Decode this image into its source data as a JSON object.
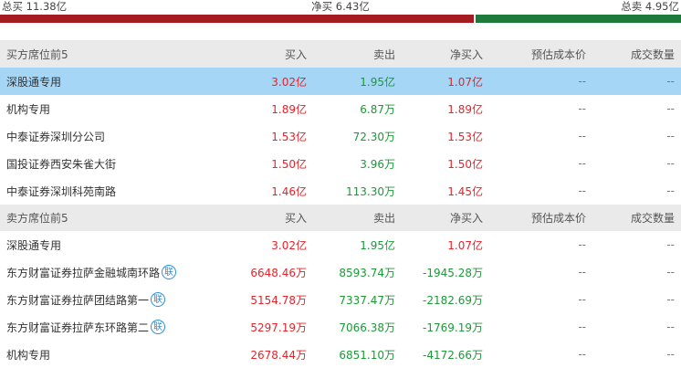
{
  "summary": {
    "total_buy_label": "总买 11.38亿",
    "net_buy_label": "净买 6.43亿",
    "total_sell_label": "总卖 4.95亿",
    "buy_bar_color": "#a61b1f",
    "sell_bar_color": "#1e7a3a",
    "buy_share": 0.697
  },
  "columns": {
    "buy": "买入",
    "sell": "卖出",
    "net": "净买入",
    "cost": "预估成本价",
    "qty": "成交数量"
  },
  "buy_section": {
    "title": "买方席位前5",
    "rows": [
      {
        "name": "深股通专用",
        "buy": "3.02亿",
        "sell": "1.95亿",
        "net": "1.07亿",
        "cost": "--",
        "qty": "--",
        "highlight": true
      },
      {
        "name": "机构专用",
        "buy": "1.89亿",
        "sell": "6.87万",
        "net": "1.89亿",
        "cost": "--",
        "qty": "--"
      },
      {
        "name": "中泰证券深圳分公司",
        "buy": "1.53亿",
        "sell": "72.30万",
        "net": "1.53亿",
        "cost": "--",
        "qty": "--"
      },
      {
        "name": "国投证券西安朱雀大街",
        "buy": "1.50亿",
        "sell": "3.96万",
        "net": "1.50亿",
        "cost": "--",
        "qty": "--"
      },
      {
        "name": "中泰证券深圳科苑南路",
        "buy": "1.46亿",
        "sell": "113.30万",
        "net": "1.45亿",
        "cost": "--",
        "qty": "--"
      }
    ]
  },
  "sell_section": {
    "title": "卖方席位前5",
    "rows": [
      {
        "name": "深股通专用",
        "buy": "3.02亿",
        "sell": "1.95亿",
        "net": "1.07亿",
        "cost": "--",
        "qty": "--"
      },
      {
        "name": "东方财富证券拉萨金融城南环路",
        "badge": "联",
        "buy": "6648.46万",
        "sell": "8593.74万",
        "net": "-1945.28万",
        "cost": "--",
        "qty": "--"
      },
      {
        "name": "东方财富证券拉萨团结路第一",
        "badge": "联",
        "buy": "5154.78万",
        "sell": "7337.47万",
        "net": "-2182.69万",
        "cost": "--",
        "qty": "--"
      },
      {
        "name": "东方财富证券拉萨东环路第二",
        "badge": "联",
        "buy": "5297.19万",
        "sell": "7066.38万",
        "net": "-1769.19万",
        "cost": "--",
        "qty": "--"
      },
      {
        "name": "机构专用",
        "buy": "2678.44万",
        "sell": "6851.10万",
        "net": "-4172.66万",
        "cost": "--",
        "qty": "--"
      }
    ]
  }
}
